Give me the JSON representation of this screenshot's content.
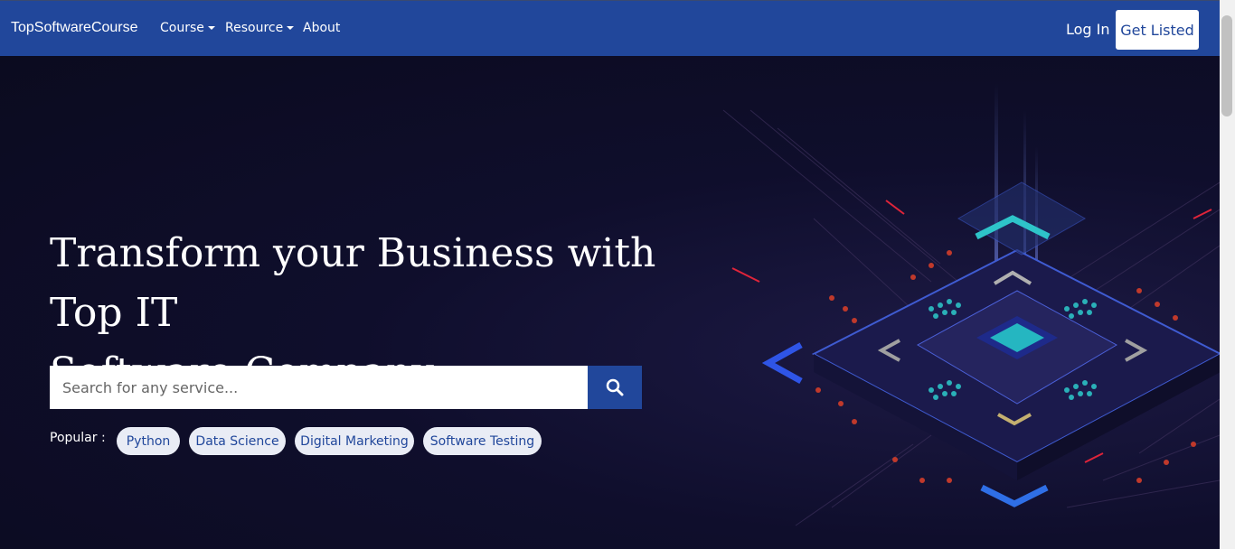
{
  "navbar": {
    "brand": "TopSoftwareCourse",
    "items": [
      {
        "label": "Course",
        "has_dropdown": true
      },
      {
        "label": "Resource",
        "has_dropdown": true
      },
      {
        "label": "About",
        "has_dropdown": false
      }
    ],
    "login_label": "Log In",
    "cta_label": "Get Listed"
  },
  "hero": {
    "headline_line1": "Transform your Business with Top IT",
    "headline_line2": "Software Company",
    "search": {
      "placeholder": "Search for any service...",
      "button_icon": "search-icon"
    },
    "popular_label": "Popular :",
    "popular_tags": [
      "Python",
      "Data Science",
      "Digital Marketing",
      "Software Testing"
    ]
  },
  "colors": {
    "brand_blue": "#21479b",
    "hero_bg": "#0d0d24",
    "tag_bg": "#e9ecf5"
  }
}
